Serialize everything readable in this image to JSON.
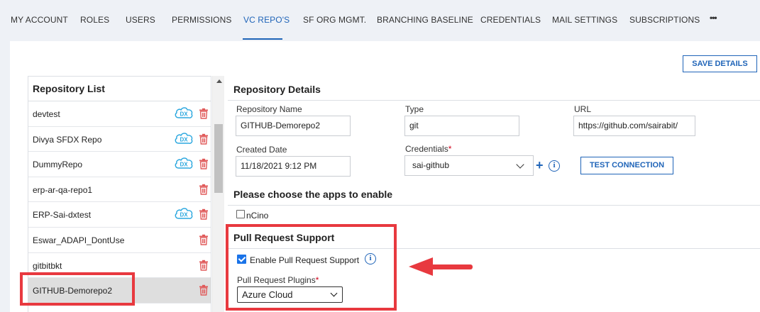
{
  "nav": {
    "tabs": [
      {
        "label": "MY ACCOUNT"
      },
      {
        "label": "ROLES"
      },
      {
        "label": "USERS"
      },
      {
        "label": "PERMISSIONS"
      },
      {
        "label": "VC REPO'S"
      },
      {
        "label": "SF ORG MGMT."
      },
      {
        "label": "BRANCHING BASELINE"
      },
      {
        "label": "CREDENTIALS"
      },
      {
        "label": "MAIL SETTINGS"
      },
      {
        "label": "SUBSCRIPTIONS"
      },
      {
        "label": "•••"
      }
    ],
    "active_tab": "VC REPO'S"
  },
  "save_details_label": "SAVE DETAILS",
  "repository_list": {
    "title": "Repository List",
    "items": [
      {
        "name": "devtest",
        "dx": true
      },
      {
        "name": "Divya SFDX Repo",
        "dx": true
      },
      {
        "name": "DummyRepo",
        "dx": true
      },
      {
        "name": "erp-ar-qa-repo1",
        "dx": false
      },
      {
        "name": "ERP-Sai-dxtest",
        "dx": true
      },
      {
        "name": "Eswar_ADAPI_DontUse",
        "dx": false
      },
      {
        "name": "gitbitbkt",
        "dx": false
      },
      {
        "name": "GITHUB-Demorepo2",
        "dx": false,
        "selected": true
      }
    ],
    "dx_badge_text": "DX"
  },
  "repository_details": {
    "title": "Repository Details",
    "repository_name": {
      "label": "Repository Name",
      "value": "GITHUB-Demorepo2"
    },
    "type": {
      "label": "Type",
      "value": "git"
    },
    "url": {
      "label": "URL",
      "value": "https://github.com/sairabit/"
    },
    "created_date": {
      "label": "Created Date",
      "value": "11/18/2021  9:12 PM"
    },
    "credentials": {
      "label": "Credentials",
      "required_mark": "*",
      "value": "sai-github"
    },
    "add_symbol": "+",
    "info_symbol": "i",
    "test_connection_label": "TEST CONNECTION"
  },
  "apps": {
    "title": "Please choose the apps to enable",
    "items": [
      {
        "label": "nCino",
        "checked": false
      }
    ]
  },
  "pull_request": {
    "title": "Pull Request Support",
    "enable_label": "Enable Pull Request Support",
    "enabled": true,
    "info_symbol": "i",
    "plugins_label": "Pull Request Plugins",
    "required_mark": "*",
    "plugin_value": "Azure Cloud"
  },
  "colors": {
    "accent": "#1f64b8",
    "annotation_red": "#e8393f",
    "dx_badge": "#2aa7df",
    "trash": "#e05a5a"
  }
}
